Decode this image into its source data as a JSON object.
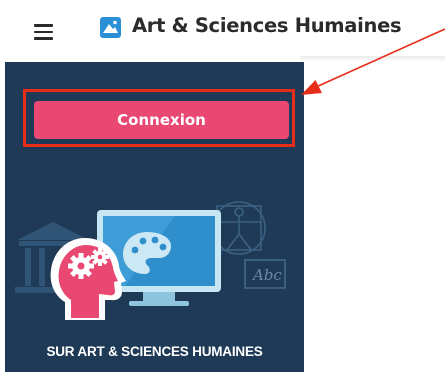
{
  "header": {
    "title": "Art & Sciences Humaines"
  },
  "sidebar": {
    "login_label": "Connexion",
    "footer_label": "SUR ART & SCIENCES HUMAINES",
    "illustration_text": "Abc"
  },
  "colors": {
    "sidebar_bg": "#1f3a57",
    "login_button": "#e84872",
    "annotation_red": "#e62d19",
    "logo_blue": "#2b8fd6"
  },
  "icons": {
    "menu": "hamburger-menu-icon",
    "logo": "app-logo-icon"
  }
}
